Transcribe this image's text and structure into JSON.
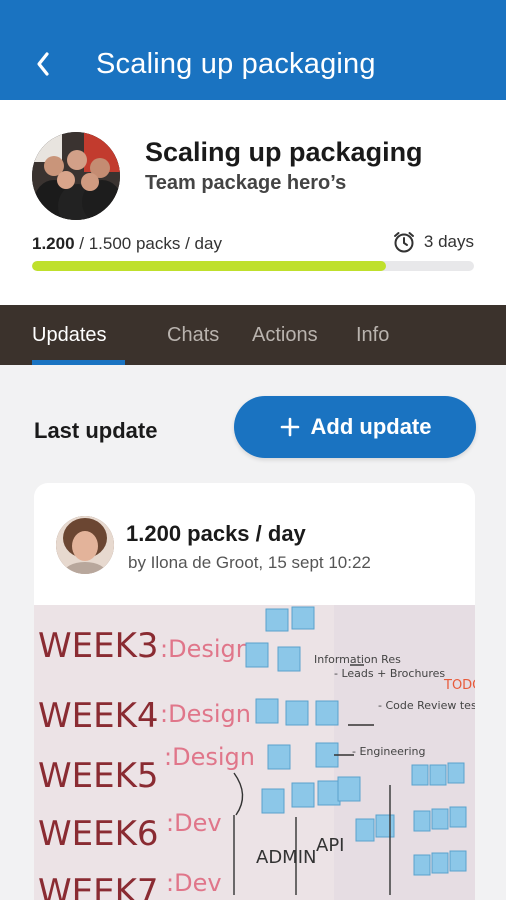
{
  "appbar": {
    "title": "Scaling up packaging",
    "back_icon": "chevron-left-icon"
  },
  "project": {
    "title": "Scaling up packaging",
    "team": "Team package hero’s",
    "progress_current": "1.200",
    "progress_rest": " / 1.500 packs / day",
    "progress_fraction": 0.8,
    "duration": "3 days",
    "colors": {
      "accent": "#1a73c1",
      "progress": "#bfe02c"
    }
  },
  "tabs": [
    {
      "label": "Updates",
      "active": true
    },
    {
      "label": "Chats",
      "active": false
    },
    {
      "label": "Actions",
      "active": false
    },
    {
      "label": "Info",
      "active": false
    }
  ],
  "updates": {
    "section_label": "Last update",
    "add_button_label": "Add update",
    "items": [
      {
        "title": "1.200 packs / day",
        "meta": "by Ilona de Groot, 15 sept 10:22"
      }
    ]
  }
}
